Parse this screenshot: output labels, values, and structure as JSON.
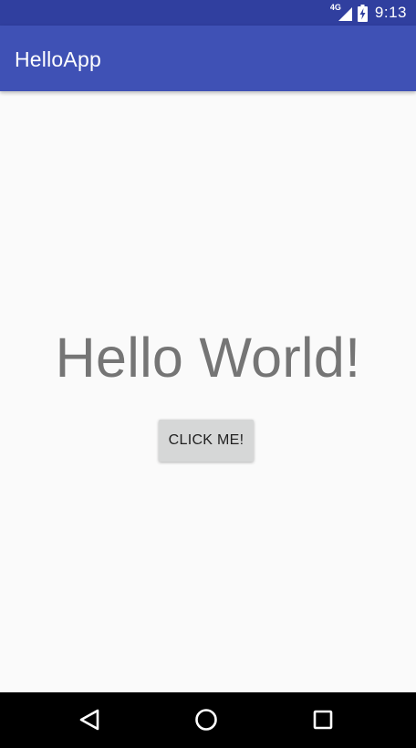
{
  "status_bar": {
    "network_type": "4G",
    "time": "9:13",
    "icons": [
      "signal-icon",
      "battery-charging-icon"
    ]
  },
  "app_bar": {
    "title": "HelloApp"
  },
  "main": {
    "greeting": "Hello World!",
    "button_label": "CLICK ME!"
  },
  "nav_bar": {
    "icons": [
      "back-icon",
      "home-icon",
      "recents-icon"
    ]
  },
  "colors": {
    "status_bar": "#303f9f",
    "app_bar": "#3f51b5",
    "background": "#fafafa",
    "greeting_text": "#757575",
    "button": "#d6d7d7",
    "nav_bar": "#000000"
  }
}
